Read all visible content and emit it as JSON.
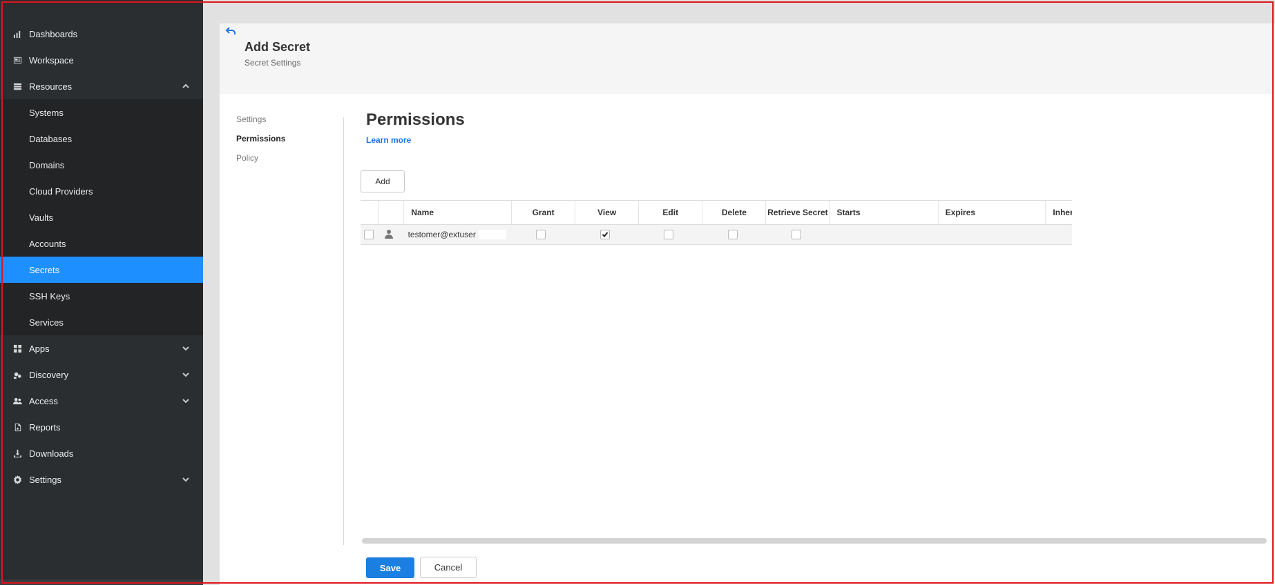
{
  "sidebar": {
    "items": [
      {
        "label": "Dashboards",
        "icon": "bar-chart-icon"
      },
      {
        "label": "Workspace",
        "icon": "workspace-icon"
      },
      {
        "label": "Resources",
        "icon": "list-icon",
        "expanded": true
      },
      {
        "label": "Apps",
        "icon": "grid-icon"
      },
      {
        "label": "Discovery",
        "icon": "discovery-icon"
      },
      {
        "label": "Access",
        "icon": "users-icon"
      },
      {
        "label": "Reports",
        "icon": "report-icon"
      },
      {
        "label": "Downloads",
        "icon": "download-icon"
      },
      {
        "label": "Settings",
        "icon": "gear-icon"
      }
    ],
    "resources_sub": [
      "Systems",
      "Databases",
      "Domains",
      "Cloud Providers",
      "Vaults",
      "Accounts",
      "Secrets",
      "SSH Keys",
      "Services"
    ],
    "active_sub": "Secrets",
    "active_color": "#1e8fff"
  },
  "header": {
    "title": "Add Secret",
    "subtitle": "Secret Settings"
  },
  "subnav": [
    "Settings",
    "Permissions",
    "Policy"
  ],
  "subnav_active": "Permissions",
  "permissions": {
    "title": "Permissions",
    "learn_more": "Learn more",
    "add_label": "Add",
    "columns": [
      "Name",
      "Grant",
      "View",
      "Edit",
      "Delete",
      "Retrieve Secret",
      "Starts",
      "Expires",
      "Inherit"
    ],
    "rows": [
      {
        "name": "testomer@extuser",
        "grant": false,
        "view": true,
        "edit": false,
        "delete": false,
        "retrieve": false,
        "starts": "",
        "expires": ""
      }
    ]
  },
  "footer": {
    "save_label": "Save",
    "cancel_label": "Cancel",
    "accent": "#1a7fe0"
  }
}
